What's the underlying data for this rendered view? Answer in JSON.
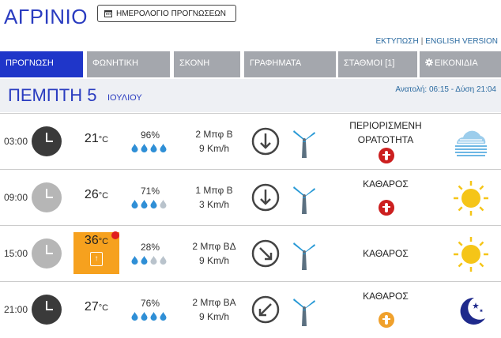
{
  "header": {
    "title": "ΑΓΡΙΝΙΟ",
    "calendar_button": "ΗΜΕΡΟΛΟΓΙΟ ΠΡΟΓΝΩΣΕΩΝ",
    "print_link": "ΕΚΤΥΠΩΣΗ",
    "separator": "|",
    "english_link": "ENGLISH VERSION"
  },
  "tabs": [
    {
      "label": "ΠΡΟΓΝΩΣΗ",
      "active": true
    },
    {
      "label": "ΦΩΝΗΤΙΚΗ",
      "active": false
    },
    {
      "label": "ΣΚΟΝΗ",
      "active": false
    },
    {
      "label": "ΓΡΑΦΗΜΑΤΑ",
      "active": false
    },
    {
      "label": "ΣΤΑΘΜΟΙ [1]",
      "active": false
    },
    {
      "label": "ΕΙΚΟΝΙΔΙΑ",
      "active": false,
      "icon": "gear-icon"
    }
  ],
  "day": {
    "name": "ΠΕΜΠΤΗ 5",
    "month": "ΙΟΥΛΙΟΥ",
    "sun": "Ανατολή: 06:15 - Δύση 21:04"
  },
  "forecasts": [
    {
      "time": "03:00",
      "clock": "dark",
      "temp": "21",
      "unit": "°C",
      "hot": false,
      "humidity": "96%",
      "drops_filled": 4,
      "wind_beaufort": "2 Μπφ Β",
      "wind_speed": "9 Km/h",
      "wind_dir_icon": "arrow-down-icon",
      "visibility_line1": "ΠΕΡΙΟΡΙΣΜΕΝΗ",
      "visibility_line2": "ΟΡΑΤΟΤΗΤΑ",
      "alert": "red",
      "weather_icon": "fog-cloud-icon"
    },
    {
      "time": "09:00",
      "clock": "light",
      "temp": "26",
      "unit": "°C",
      "hot": false,
      "humidity": "71%",
      "drops_filled": 3,
      "wind_beaufort": "1 Μπφ Β",
      "wind_speed": "3 Km/h",
      "wind_dir_icon": "arrow-down-icon",
      "visibility_line1": "ΚΑΘΑΡΟΣ",
      "visibility_line2": "",
      "alert": "red",
      "weather_icon": "sun-icon"
    },
    {
      "time": "15:00",
      "clock": "light",
      "temp": "36",
      "unit": "°C",
      "hot": true,
      "humidity": "28%",
      "drops_filled": 2,
      "wind_beaufort": "2 Μπφ ΒΔ",
      "wind_speed": "9 Km/h",
      "wind_dir_icon": "arrow-down-right-icon",
      "visibility_line1": "ΚΑΘΑΡΟΣ",
      "visibility_line2": "",
      "alert": "none",
      "weather_icon": "sun-icon"
    },
    {
      "time": "21:00",
      "clock": "dark",
      "temp": "27",
      "unit": "°C",
      "hot": false,
      "humidity": "76%",
      "drops_filled": 4,
      "wind_beaufort": "2 Μπφ ΒΑ",
      "wind_speed": "9 Km/h",
      "wind_dir_icon": "arrow-down-left-icon",
      "visibility_line1": "ΚΑΘΑΡΟΣ",
      "visibility_line2": "",
      "alert": "orange",
      "weather_icon": "moon-stars-icon"
    }
  ],
  "colors": {
    "brand_blue": "#1f36c9",
    "tab_grey": "#a4a7ad",
    "hot_orange": "#f6a11e",
    "drop_blue": "#2f8fd6",
    "sun_yellow": "#f5c518"
  }
}
